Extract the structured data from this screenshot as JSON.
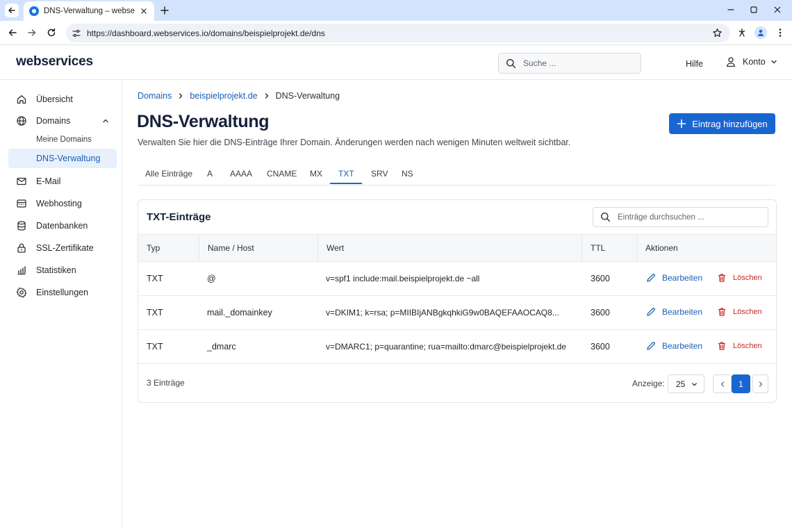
{
  "browser": {
    "tab_title": "DNS-Verwaltung – webservices",
    "url": "https://dashboard.webservices.io/domains/beispielprojekt.de/dns"
  },
  "header": {
    "logo": "webservices",
    "search_placeholder": "Suche ...",
    "help": "Hilfe",
    "account": "Konto"
  },
  "sidebar": {
    "items": [
      {
        "label": "Übersicht",
        "icon": "home-icon"
      },
      {
        "label": "Domains",
        "icon": "globe-icon",
        "expanded": true
      },
      {
        "label": "E-Mail",
        "icon": "mail-icon"
      },
      {
        "label": "Webhosting",
        "icon": "server-icon"
      },
      {
        "label": "Datenbanken",
        "icon": "database-icon"
      },
      {
        "label": "SSL-Zertifikate",
        "icon": "lock-icon"
      },
      {
        "label": "Statistiken",
        "icon": "chart-icon"
      },
      {
        "label": "Einstellungen",
        "icon": "gear-icon"
      }
    ],
    "sub_items": [
      {
        "label": "Meine Domains"
      },
      {
        "label": "DNS-Verwaltung",
        "active": true
      }
    ]
  },
  "breadcrumb": [
    "Domains",
    "beispielprojekt.de",
    "DNS-Verwaltung"
  ],
  "page": {
    "title": "DNS-Verwaltung",
    "subtitle": "Verwalten Sie hier die DNS-Einträge Ihrer Domain. Änderungen werden nach wenigen Minuten weltweit sichtbar.",
    "add_button": "Eintrag hinzufügen"
  },
  "tabs": [
    "Alle Einträge",
    "A",
    "AAAA",
    "CNAME",
    "MX",
    "TXT",
    "SRV",
    "NS"
  ],
  "active_tab": "TXT",
  "card": {
    "title": "TXT-Einträge",
    "search_placeholder": "Einträge durchsuchen ...",
    "columns": [
      "Typ",
      "Name / Host",
      "Wert",
      "TTL",
      "Aktionen"
    ],
    "rows": [
      {
        "type": "TXT",
        "name": "@",
        "value": "v=spf1 include:mail.beispielprojekt.de ~all",
        "ttl": "3600"
      },
      {
        "type": "TXT",
        "name": "mail._domainkey",
        "value": "v=DKIM1; k=rsa; p=MIIBIjANBgkqhkiG9w0BAQEFAAOCAQ8...",
        "ttl": "3600"
      },
      {
        "type": "TXT",
        "name": "_dmarc",
        "value": "v=DMARC1; p=quarantine; rua=mailto:dmarc@beispielprojekt.de",
        "ttl": "3600"
      }
    ],
    "edit_label": "Bearbeiten",
    "delete_label": "Löschen",
    "count_text": "3 Einträge",
    "page_size_label": "Anzeige:",
    "page_size": "25",
    "current_page": "1"
  },
  "colors": {
    "accent": "#1a66d1",
    "danger": "#c62828",
    "active_bg": "#e8f0fb"
  }
}
